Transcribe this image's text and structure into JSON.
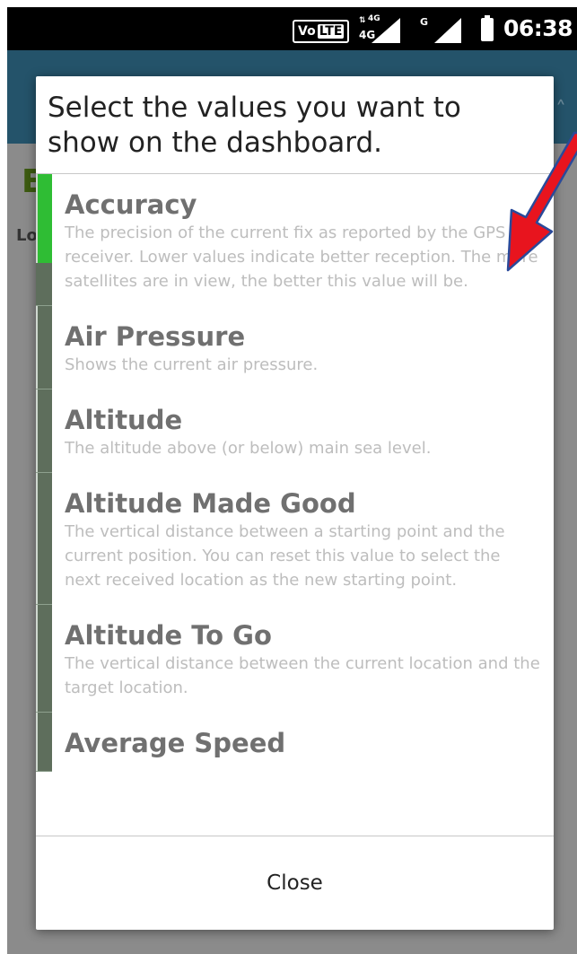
{
  "status_bar": {
    "volte_label": "Vo",
    "lte_label": "LTE",
    "net_top": "4G",
    "net_bottom": "4G",
    "sim2_label": "G",
    "time": "06:38"
  },
  "background": {
    "partial_letter": "E",
    "partial_label": "Lo"
  },
  "dialog": {
    "title": "Select the values you want to show on the dashboard.",
    "items": [
      {
        "title": "Accuracy",
        "description": "The precision of the current fix as reported by the GPS receiver. Lower values indicate better reception. The more satellites are in view, the better this value will be."
      },
      {
        "title": "Air Pressure",
        "description": "Shows the current air pressure."
      },
      {
        "title": "Altitude",
        "description": "The altitude above (or below) main sea level."
      },
      {
        "title": "Altitude Made Good",
        "description": "The vertical distance between a starting point and the current position. You can reset this value to select the next received location as the new starting point."
      },
      {
        "title": "Altitude To Go",
        "description": "The vertical distance between the current location and the target location."
      },
      {
        "title": "Average Speed",
        "description": ""
      }
    ],
    "close_label": "Close"
  },
  "colors": {
    "app_bar": "#24536a",
    "selected_indicator": "#2fbd34",
    "unselected_indicator": "#5e6e5c",
    "annotation_arrow": "#e8141e"
  }
}
